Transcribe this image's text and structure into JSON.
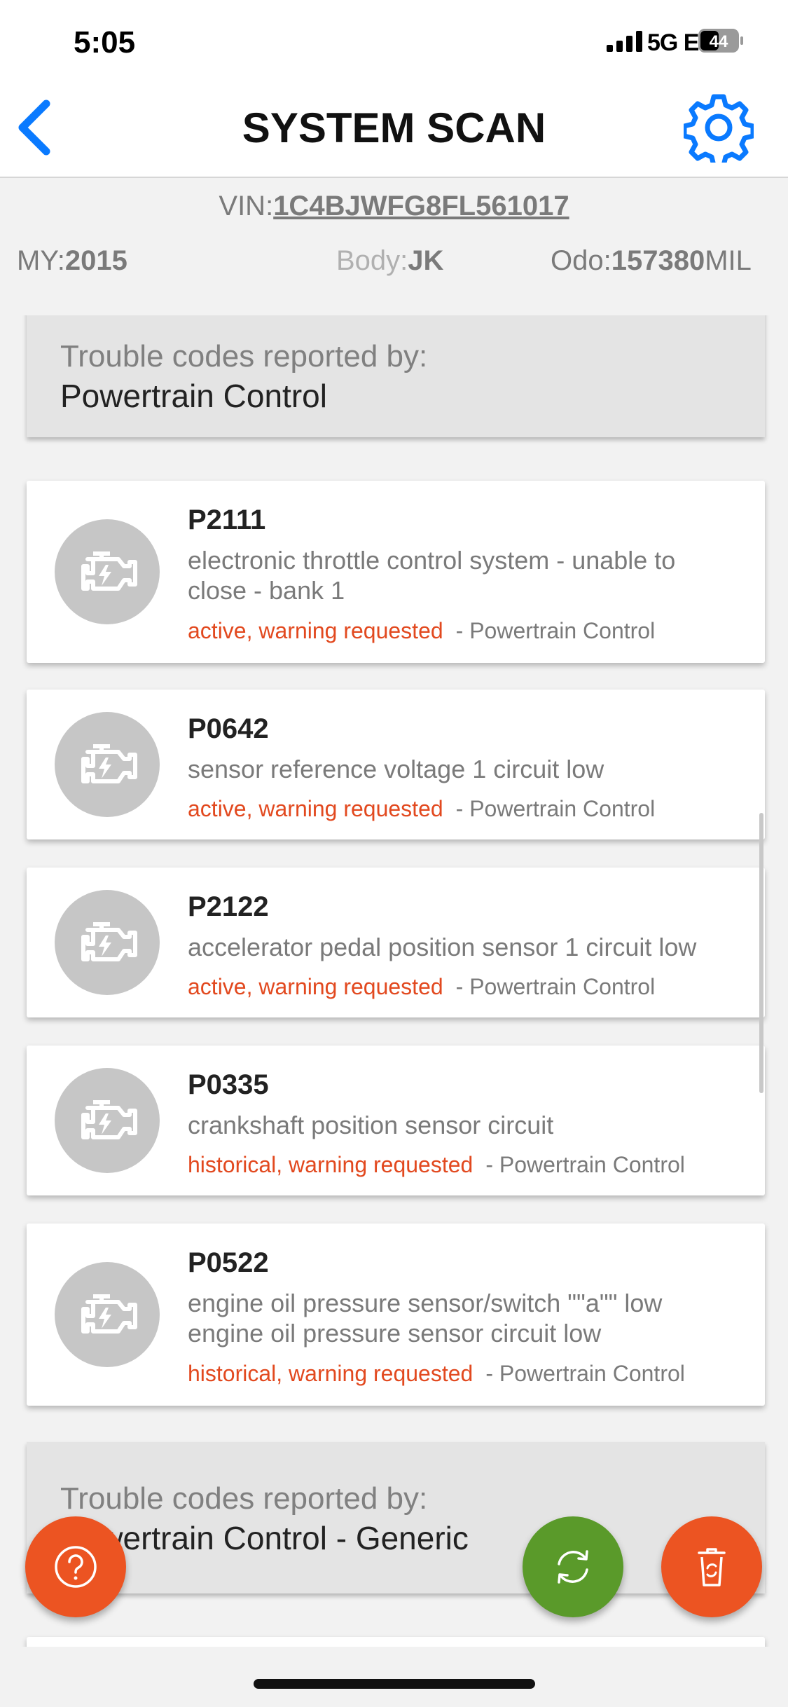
{
  "status_bar": {
    "time": "5:05",
    "network": "5G E",
    "battery": "44"
  },
  "header": {
    "title": "SYSTEM SCAN"
  },
  "vehicle": {
    "vin_label": "VIN:",
    "vin": "1C4BJWFG8FL561017",
    "my_label": "MY:",
    "my": "2015",
    "body_label": "Body:",
    "body": "JK",
    "odo_label": "Odo:",
    "odo": "157380",
    "odo_unit": "MIL"
  },
  "sections": [
    {
      "label": "Trouble codes reported by:",
      "name": "Powertrain Control"
    },
    {
      "label": "Trouble codes reported by:",
      "name": "Powertrain Control - Generic"
    }
  ],
  "dtcs": [
    {
      "code": "P2111",
      "desc1": "electronic throttle control system - unable to",
      "desc2": "close - bank 1",
      "status": "active, warning requested",
      "module": "- Powertrain Control"
    },
    {
      "code": "P0642",
      "desc1": "sensor reference voltage 1 circuit low",
      "desc2": "",
      "status": "active, warning requested",
      "module": "- Powertrain Control"
    },
    {
      "code": "P2122",
      "desc1": "accelerator pedal position sensor 1 circuit low",
      "desc2": "",
      "status": "active, warning requested",
      "module": "- Powertrain Control"
    },
    {
      "code": "P0335",
      "desc1": "crankshaft position sensor circuit",
      "desc2": "",
      "status": "historical, warning requested",
      "module": "- Powertrain Control"
    },
    {
      "code": "P0522",
      "desc1": "engine oil pressure sensor/switch \"\"a\"\" low",
      "desc2": "engine oil pressure sensor circuit low",
      "status": "historical, warning requested",
      "module": "- Powertrain Control"
    }
  ],
  "colors": {
    "accent_blue": "#0a7aff",
    "status_orange": "#e2491f",
    "fab_orange": "#ec5422",
    "fab_green": "#5a9a2a"
  },
  "icons": {
    "back": "chevron-left-icon",
    "settings": "gear-icon",
    "engine": "check-engine-icon",
    "help": "question-icon",
    "refresh": "refresh-icon",
    "clear": "trash-refresh-icon"
  }
}
